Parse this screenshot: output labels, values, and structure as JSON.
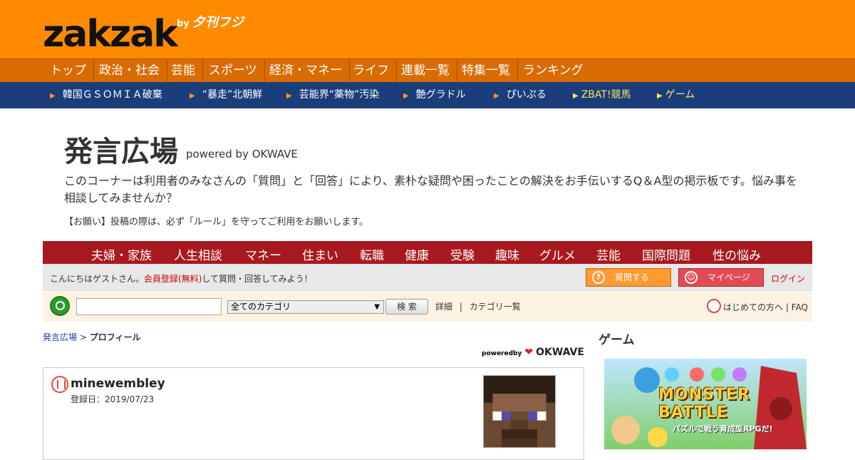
{
  "header": {
    "logo": "zakzak",
    "byline": "by",
    "brand": "夕刊フジ"
  },
  "nav_main": [
    "トップ",
    "政治・社会",
    "芸能",
    "スポーツ",
    "経済・マネー",
    "ライフ",
    "連載一覧",
    "特集一覧",
    "ランキング"
  ],
  "nav_topics": [
    "韓国ＧＳＯＭＩＡ破棄",
    "“暴走”北朝鮮",
    "芸能界“薬物”汚染",
    "艶グラドル",
    "ぴいぷる",
    "ZBAT!競馬",
    "ゲーム"
  ],
  "page": {
    "title": "発言広場",
    "powered": "powered by OKWAVE",
    "intro": "このコーナーは利用者のみなさんの「質問」と「回答」により、素朴な疑問や困ったことの解決をお手伝いするQ＆A型の掲示板です。悩み事を相談してみませんか？",
    "notice": "【お願い】投稿の際は、必ず「ルール」を守ってご利用をお願いします。"
  },
  "categories": [
    "夫婦・家族",
    "人生相談",
    "マネー",
    "住まい",
    "転職",
    "健康",
    "受験",
    "趣味",
    "グルメ",
    "芸能",
    "国際問題",
    "性の悩み"
  ],
  "greeting": {
    "prefix": "こんにちはゲストさん。",
    "link": "会員登録(無料)",
    "suffix": "して質問・回答してみよう！",
    "ask_button": "質問する",
    "mypage_button": "マイページ",
    "login": "ログイン"
  },
  "search": {
    "input_value": "",
    "category_selected": "全てのカテゴリ",
    "button": "検 索",
    "detail": "詳細",
    "separator": "|",
    "category_list": "カテゴリ一覧",
    "help": "はじめての方へ | FAQ"
  },
  "breadcrumb": {
    "root": "発言広場",
    "sep": ">",
    "current": "プロフィール"
  },
  "okwave_badge": {
    "powered": "poweredby",
    "brand": "OKWAVE"
  },
  "profile": {
    "username": "minewembley",
    "registered": "登録日：2019/07/23"
  },
  "sidebar": {
    "title": "ゲーム",
    "banner_title": "MONSTER BATTLE",
    "banner_sub": "パズルで戦う育成型RPGだ!"
  }
}
